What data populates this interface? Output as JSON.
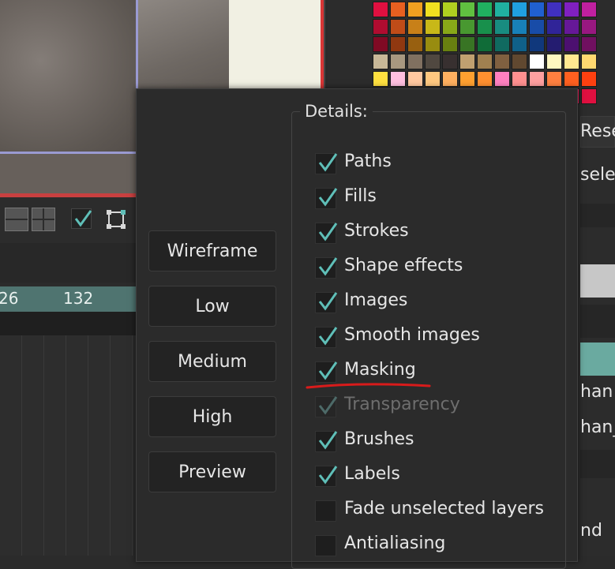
{
  "colors": {
    "accent_check": "#5fbfb8",
    "timeline": "#4f7470",
    "annotation": "#d81b1b",
    "canvas_border": "#9a9ad2",
    "selected_row": "#6aaaa0"
  },
  "timeline": {
    "labels": [
      "26",
      "132"
    ]
  },
  "right_panel": {
    "rows": [
      {
        "id": "reset",
        "text": "Rese"
      },
      {
        "id": "select",
        "text": "selec"
      },
      {
        "id": "han1",
        "text": "han"
      },
      {
        "id": "han2",
        "text": "han_"
      },
      {
        "id": "nd",
        "text": "nd"
      }
    ]
  },
  "palette": [
    [
      "#e01040",
      "#e86020",
      "#f0a020",
      "#f0e020",
      "#b0d020",
      "#60c040",
      "#20b060",
      "#20b0a0",
      "#20a0e0",
      "#2060d0",
      "#4030c0",
      "#8020c0",
      "#c020a0"
    ],
    [
      "#b00c30",
      "#c04c18",
      "#c88018",
      "#c8b818",
      "#88a818",
      "#489830",
      "#18904c",
      "#188c80",
      "#1880b8",
      "#184ca8",
      "#302498",
      "#661898",
      "#981880"
    ],
    [
      "#800a24",
      "#903810",
      "#986010",
      "#988c10",
      "#688010",
      "#387424",
      "#106c38",
      "#106a60",
      "#106088",
      "#10387c",
      "#241c70",
      "#4c1070",
      "#701060"
    ],
    [
      "#c8b898",
      "#a89880",
      "#807060",
      "#504840",
      "#383030",
      "#c0a070",
      "#a08050",
      "#806040",
      "#604830",
      "#ffffff",
      "#fff8c0",
      "#ffe890",
      "#ffd870"
    ],
    [
      "#ffe040",
      "#ffc0e0",
      "#ffc8a0",
      "#ffc880",
      "#ffb060",
      "#ffa030",
      "#ff9030",
      "#ff80c0",
      "#ff9090",
      "#ffa0a0",
      "#ff8040",
      "#ff6020",
      "#ff4010"
    ],
    [
      "#ff3070",
      "#ff3080",
      "#ff2060",
      "#ff4090",
      "#ff2050",
      "#ff3060",
      "#ff4060",
      "#ff3050",
      "#ff2040",
      "#ff3040",
      "#ff2030",
      "#ff2060",
      "#e01040"
    ]
  ],
  "quality_buttons": [
    {
      "id": "wireframe",
      "label": "Wireframe"
    },
    {
      "id": "low",
      "label": "Low"
    },
    {
      "id": "medium",
      "label": "Medium"
    },
    {
      "id": "high",
      "label": "High"
    },
    {
      "id": "preview",
      "label": "Preview"
    }
  ],
  "details": {
    "title": "Details:",
    "options": [
      {
        "id": "paths",
        "label": "Paths",
        "checked": true,
        "enabled": true
      },
      {
        "id": "fills",
        "label": "Fills",
        "checked": true,
        "enabled": true
      },
      {
        "id": "strokes",
        "label": "Strokes",
        "checked": true,
        "enabled": true
      },
      {
        "id": "shape-effects",
        "label": "Shape effects",
        "checked": true,
        "enabled": true
      },
      {
        "id": "images",
        "label": "Images",
        "checked": true,
        "enabled": true
      },
      {
        "id": "smooth-images",
        "label": "Smooth images",
        "checked": true,
        "enabled": true
      },
      {
        "id": "masking",
        "label": "Masking",
        "checked": true,
        "enabled": true
      },
      {
        "id": "transparency",
        "label": "Transparency",
        "checked": true,
        "enabled": false
      },
      {
        "id": "brushes",
        "label": "Brushes",
        "checked": true,
        "enabled": true
      },
      {
        "id": "labels",
        "label": "Labels",
        "checked": true,
        "enabled": true
      },
      {
        "id": "fade-unselected-layers",
        "label": "Fade unselected layers",
        "checked": false,
        "enabled": true
      },
      {
        "id": "antialiasing",
        "label": "Antialiasing",
        "checked": false,
        "enabled": true
      }
    ]
  }
}
